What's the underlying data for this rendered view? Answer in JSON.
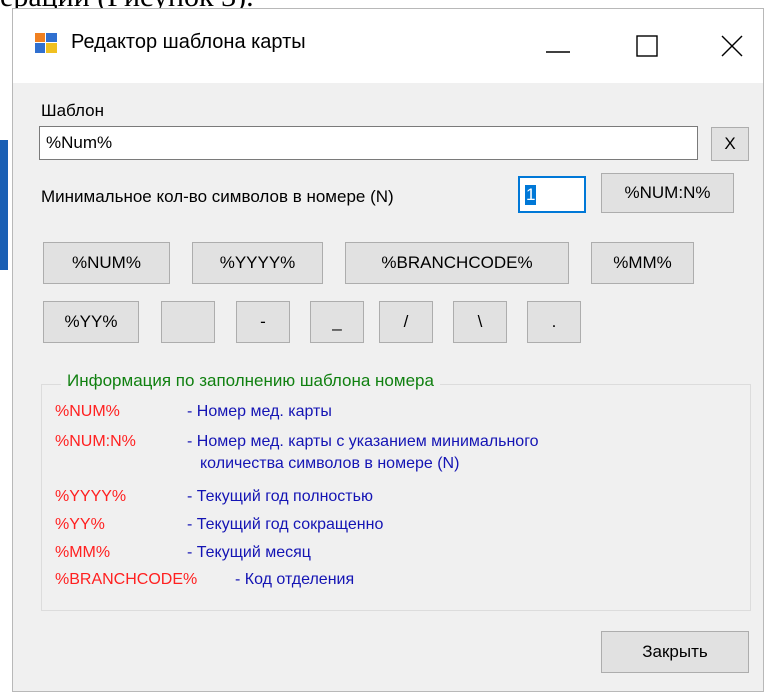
{
  "window": {
    "title": "Редактор шаблона карты"
  },
  "form": {
    "template_label": "Шаблон",
    "template_value": "%Num%",
    "clear_label": "X",
    "min_symbols_label": "Минимальное кол-во символов в номере (N)",
    "min_symbols_value": "1",
    "num_n_label": "%NUM:N%"
  },
  "token_buttons": {
    "num": "%NUM%",
    "yyyy": "%YYYY%",
    "branchcode": "%BRANCHCODE%",
    "mm": "%MM%",
    "yy": "%YY%",
    "space": "",
    "dash": "-",
    "underscore": "_",
    "slash": "/",
    "backslash": "\\",
    "dot": "."
  },
  "info": {
    "title": "Информация по заполнению шаблона номера",
    "rows": [
      {
        "code": "%NUM%",
        "desc": "- Номер мед. карты"
      },
      {
        "code": "%NUM:N%",
        "desc": "- Номер мед. карты с указанием минимального",
        "desc2": "количества символов в номере (N)"
      },
      {
        "code": "%YYYY%",
        "desc": "- Текущий год полностью"
      },
      {
        "code": "%YY%",
        "desc": "- Текущий год сокращенно"
      },
      {
        "code": "%MM%",
        "desc": "- Текущий месяц"
      },
      {
        "code": "%BRANCHCODE%",
        "desc": "- Код отделения"
      }
    ]
  },
  "footer": {
    "close_label": "Закрыть"
  },
  "background": {
    "partial_text": "ерации (Рисунок 3)."
  },
  "colors": {
    "info_title": "#108010",
    "code": "#ff2020",
    "desc": "#1414b4",
    "focus": "#0078d7"
  }
}
